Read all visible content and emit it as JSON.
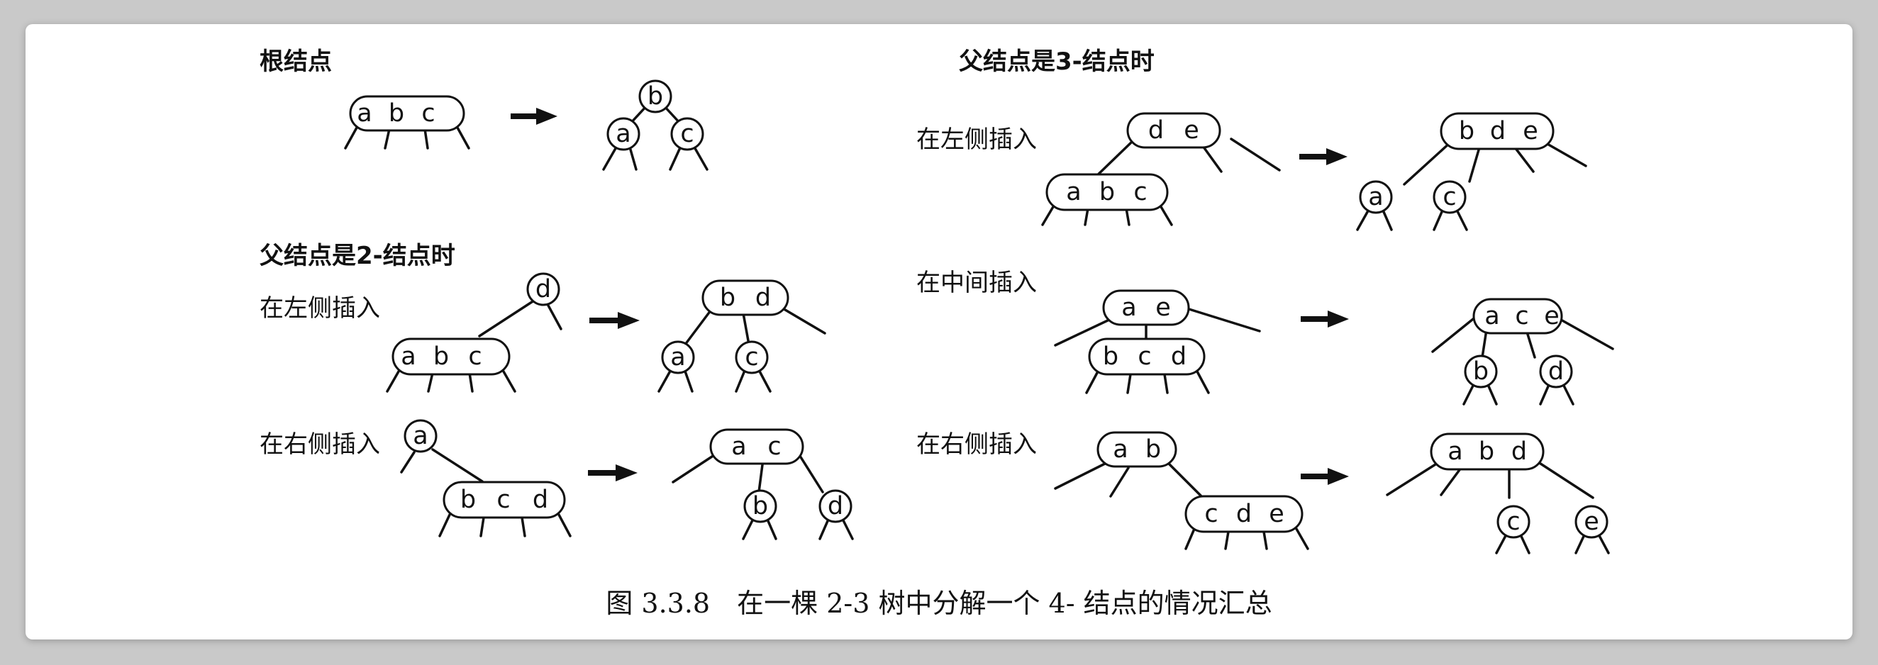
{
  "headings": {
    "root": "根结点",
    "parent_2_node": "父结点是2-结点时",
    "parent_3_node": "父结点是3-结点时"
  },
  "labels": {
    "left_insert": "在左侧插入",
    "middle_insert": "在中间插入",
    "right_insert": "在右侧插入"
  },
  "caption": "图 3.3.8　在一棵 2-3 树中分解一个 4- 结点的情况汇总",
  "keys": [
    "a",
    "b",
    "c",
    "d",
    "e"
  ],
  "cases": [
    {
      "group": "根结点",
      "position": "",
      "before": "a b c",
      "after": [
        "b",
        "a",
        "c"
      ]
    },
    {
      "group": "父结点是2-结点时",
      "position": "在左侧插入",
      "before": [
        "d",
        "a b c"
      ],
      "after": [
        "b d",
        "a",
        "c"
      ]
    },
    {
      "group": "父结点是2-结点时",
      "position": "在右侧插入",
      "before": [
        "a",
        "b c d"
      ],
      "after": [
        "a c",
        "b",
        "d"
      ]
    },
    {
      "group": "父结点是3-结点时",
      "position": "在左侧插入",
      "before": [
        "d e",
        "a b c"
      ],
      "after": [
        "b d e",
        "a",
        "c"
      ]
    },
    {
      "group": "父结点是3-结点时",
      "position": "在中间插入",
      "before": [
        "a e",
        "b c d"
      ],
      "after": [
        "a c e",
        "b",
        "d"
      ]
    },
    {
      "group": "父结点是3-结点时",
      "position": "在右侧插入",
      "before": [
        "a b",
        "c d e"
      ],
      "after": [
        "a b d",
        "c",
        "e"
      ]
    }
  ],
  "colors": {
    "ink": "#111111",
    "background": "#ffffff",
    "backdrop": "#c9c9c9"
  }
}
